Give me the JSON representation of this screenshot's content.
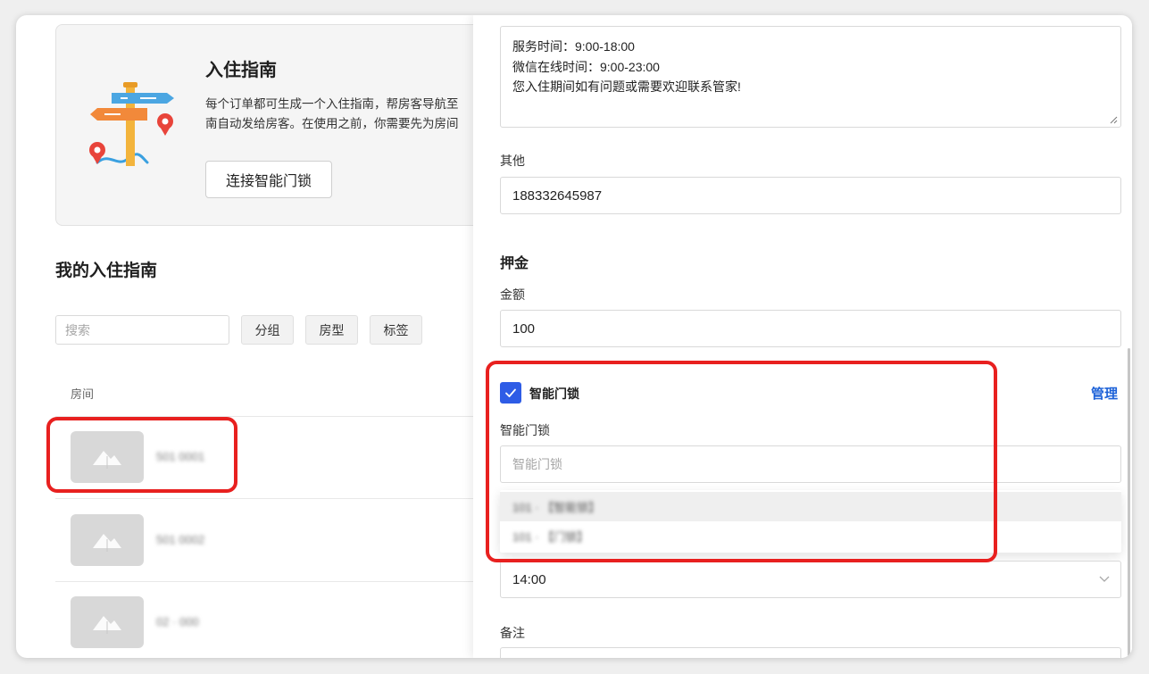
{
  "colors": {
    "accent": "#2e5ce6",
    "link": "#1d62d8",
    "annotation": "#e8201f"
  },
  "guide_card": {
    "title": "入住指南",
    "description_lines": [
      "每个订单都可生成一个入住指南，帮房客导航至",
      "南自动发给房客。在使用之前，你需要先为房间"
    ],
    "connect_button": "连接智能门锁",
    "illustration_icon": "signpost-icon"
  },
  "my_guides": {
    "title": "我的入住指南",
    "search_placeholder": "搜索",
    "filters": [
      "分组",
      "房型",
      "标签"
    ],
    "column_room": "房间",
    "rooms": [
      {
        "name": "501 0001",
        "thumbnail_icon": "image-placeholder-icon"
      },
      {
        "name": "501 0002",
        "thumbnail_icon": "image-placeholder-icon"
      },
      {
        "name": "02 · 000",
        "thumbnail_icon": "image-placeholder-icon"
      }
    ]
  },
  "drawer": {
    "contact_lines": [
      "服务时间：9:00-18:00",
      "微信在线时间：9:00-23:00",
      "您入住期间如有问题或需要欢迎联系管家!"
    ],
    "other": {
      "label": "其他",
      "value": "188332645987"
    },
    "deposit": {
      "section_title": "押金",
      "amount_label": "金额",
      "amount_value": "100"
    },
    "smart_lock": {
      "checkbox_label": "智能门锁",
      "checked": true,
      "manage_link": "管理",
      "field_label": "智能门锁",
      "select_placeholder": "智能门锁",
      "options": [
        "101 · 【智能锁】",
        "101 · 【门锁】"
      ]
    },
    "checkin_time": {
      "value": "14:00"
    },
    "remarks": {
      "label": "备注"
    }
  }
}
